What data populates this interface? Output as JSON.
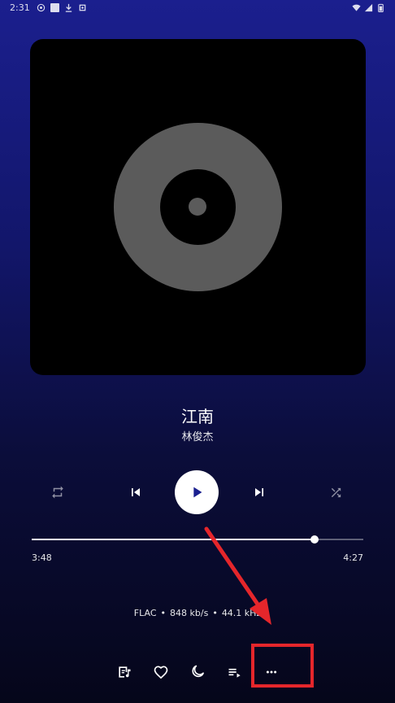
{
  "status_bar": {
    "time": "2:31",
    "left_icons": [
      "radio-icon",
      "square-icon",
      "download-icon",
      "settings-icon"
    ],
    "right_icons": [
      "wifi-icon",
      "signal-icon",
      "battery-icon"
    ]
  },
  "album": {
    "placeholder_icon": "vinyl-disc-icon"
  },
  "track": {
    "title": "江南",
    "artist": "林俊杰"
  },
  "controls": {
    "repeat_icon": "repeat-icon",
    "previous_icon": "skip-previous-icon",
    "play_icon": "play-icon",
    "next_icon": "skip-next-icon",
    "shuffle_icon": "shuffle-icon"
  },
  "progress": {
    "elapsed": "3:48",
    "total": "4:27",
    "fraction": 0.853
  },
  "audio_info": {
    "format": "FLAC",
    "bitrate": "848 kb/s",
    "sample_rate": "44.1 kHz",
    "separator": "•"
  },
  "bottom_actions": [
    "lyrics-icon",
    "heart-icon",
    "sleep-timer-icon",
    "queue-icon",
    "more-icon"
  ],
  "colors": {
    "accent_play": "#ffffff",
    "background_top": "#1b1f8e",
    "background_bottom": "#05061a",
    "annotation": "#e5262b"
  }
}
